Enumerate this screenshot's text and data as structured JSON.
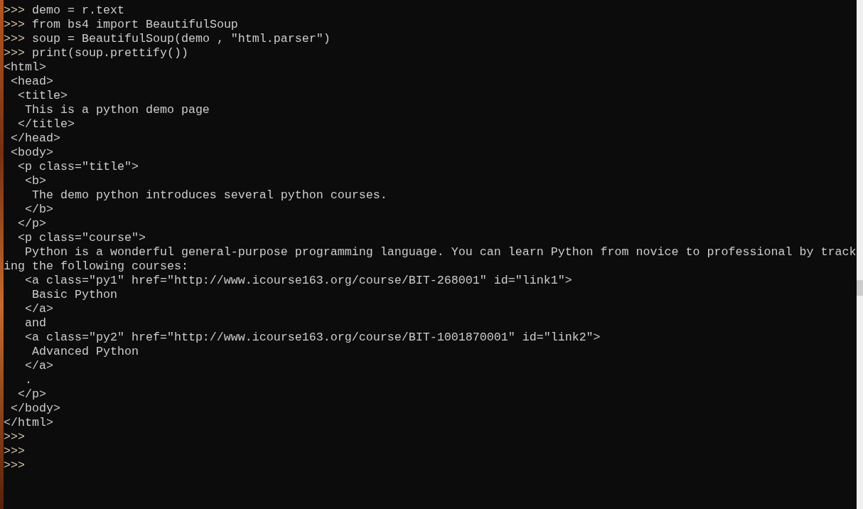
{
  "terminal": {
    "lines": [
      {
        "kind": "prompt",
        "prompt": ">>>",
        "command": "demo = r.text"
      },
      {
        "kind": "prompt",
        "prompt": ">>>",
        "command": "from bs4 import BeautifulSoup"
      },
      {
        "kind": "prompt",
        "prompt": ">>>",
        "command": "soup = BeautifulSoup(demo , \"html.parser\")"
      },
      {
        "kind": "prompt",
        "prompt": ">>>",
        "command": "print(soup.prettify())"
      },
      {
        "kind": "output",
        "text": "<html>"
      },
      {
        "kind": "output",
        "text": " <head>"
      },
      {
        "kind": "output",
        "text": "  <title>"
      },
      {
        "kind": "output",
        "text": "   This is a python demo page"
      },
      {
        "kind": "output",
        "text": "  </title>"
      },
      {
        "kind": "output",
        "text": " </head>"
      },
      {
        "kind": "output",
        "text": " <body>"
      },
      {
        "kind": "output",
        "text": "  <p class=\"title\">"
      },
      {
        "kind": "output",
        "text": "   <b>"
      },
      {
        "kind": "output",
        "text": "    The demo python introduces several python courses."
      },
      {
        "kind": "output",
        "text": "   </b>"
      },
      {
        "kind": "output",
        "text": "  </p>"
      },
      {
        "kind": "output",
        "text": "  <p class=\"course\">"
      },
      {
        "kind": "output",
        "text": "   Python is a wonderful general-purpose programming language. You can learn Python from novice to professional by track"
      },
      {
        "kind": "output",
        "text": "ing the following courses:"
      },
      {
        "kind": "output",
        "text": "   <a class=\"py1\" href=\"http://www.icourse163.org/course/BIT-268001\" id=\"link1\">"
      },
      {
        "kind": "output",
        "text": "    Basic Python"
      },
      {
        "kind": "output",
        "text": "   </a>"
      },
      {
        "kind": "output",
        "text": "   and"
      },
      {
        "kind": "output",
        "text": "   <a class=\"py2\" href=\"http://www.icourse163.org/course/BIT-1001870001\" id=\"link2\">"
      },
      {
        "kind": "output",
        "text": "    Advanced Python"
      },
      {
        "kind": "output",
        "text": "   </a>"
      },
      {
        "kind": "output",
        "text": "   ."
      },
      {
        "kind": "output",
        "text": "  </p>"
      },
      {
        "kind": "output",
        "text": " </body>"
      },
      {
        "kind": "output",
        "text": "</html>"
      },
      {
        "kind": "prompt",
        "prompt": ">>>"
      },
      {
        "kind": "prompt",
        "prompt": ">>>"
      },
      {
        "kind": "prompt",
        "prompt": ">>>"
      }
    ]
  }
}
